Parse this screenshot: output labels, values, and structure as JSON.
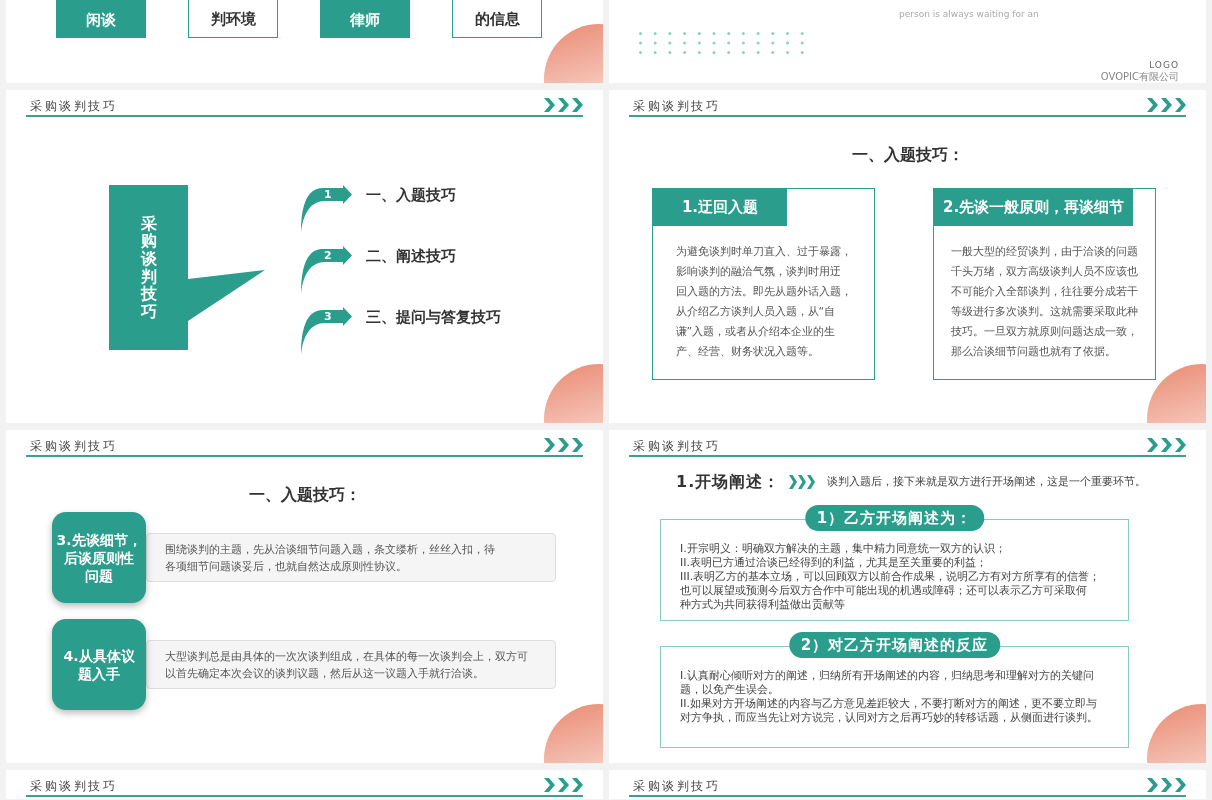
{
  "slides": [
    {
      "kind": "boxes",
      "boxes": [
        {
          "kind": "filled",
          "text": "闲谈"
        },
        {
          "kind": "outline",
          "text": "判环境"
        },
        {
          "kind": "filled",
          "text": "律师"
        },
        {
          "kind": "outline",
          "text": "的信息"
        }
      ]
    },
    {
      "kind": "cover",
      "tagline": "person is always waiting for an",
      "logo": "LOGO",
      "company": "OVOPIC有限公司"
    },
    {
      "kind": "agenda",
      "header": "采购谈判技巧",
      "title": "采购谈判技巧",
      "items": [
        {
          "number": "1",
          "label": "一、入题技巧"
        },
        {
          "number": "2",
          "label": "二、阐述技巧"
        },
        {
          "number": "3",
          "label": "三、提问与答复技巧"
        }
      ]
    },
    {
      "kind": "cards",
      "header": "采购谈判技巧",
      "heading": "一、入题技巧：",
      "cards": [
        {
          "title": "1.迂回入题",
          "lines": [
            "为避免谈判时单刀直入、过于暴露，",
            "影响谈判的融洽气氛，谈判时用迂",
            "回入题的方法。即先从题外话入题，",
            "从介绍乙方谈判人员入题，从“自",
            "谦”入题，或者从介绍本企业的生",
            "产、经营、财务状况入题等。"
          ]
        },
        {
          "title": "2.先谈一般原则，再谈细节",
          "lines": [
            "一般大型的经贸谈判，由于洽谈的问题",
            "千头万绪，双方高级谈判人员不应该也",
            "不可能介入全部谈判，往往要分成若干",
            "等级进行多次谈判。这就需要采取此种",
            "技巧。一旦双方就原则问题达成一致，",
            "那么洽谈细节问题也就有了依据。"
          ]
        }
      ]
    },
    {
      "kind": "rows",
      "header": "采购谈判技巧",
      "heading": "一、入题技巧：",
      "rows": [
        {
          "title_lines": [
            "3.先谈细节，",
            "后谈原则性",
            "问题"
          ],
          "lines": [
            "围绕谈判的主题，先从洽谈细节问题入题，条文缕析，丝丝入扣，待",
            "各项细节问题谈妥后，也就自然达成原则性协议。"
          ]
        },
        {
          "title_lines": [
            "4.从具体议",
            "题入手"
          ],
          "lines": [
            "大型谈判总是由具体的一次次谈判组成，在具体的每一次谈判会上，双方可",
            "以首先确定本次会议的谈判议题，然后从这一议题入手就行洽谈。"
          ]
        }
      ]
    },
    {
      "kind": "statement",
      "header": "采购谈判技巧",
      "heading": "1.开场阐述：",
      "intro": "谈判入题后，接下来就是双方进行开场阐述，这是一个重要环节。",
      "sections": [
        {
          "title": "1）乙方开场阐述为：",
          "lines": [
            "I.开宗明义：明确双方解决的主题，集中精力同意统一双方的认识；",
            "II.表明已方通过洽谈已经得到的利益，尤其是至关重要的利益；",
            "III.表明乙方的基本立场，可以回顾双方以前合作成果，说明乙方有对方所享有的信誉；",
            "也可以展望或预测今后双方合作中可能出现的机遇或障碍；还可以表示乙方可采取何",
            "种方式为共同获得利益做出贡献等"
          ]
        },
        {
          "title": "2）对乙方开场阐述的反应",
          "lines": [
            "I.认真耐心倾听对方的阐述，归纳所有开场阐述的内容，归纳思考和理解对方的关键问",
            "题，以免产生误会。",
            "II.如果对方开场阐述的内容与乙方意见差距较大，不要打断对方的阐述，更不要立即与",
            "对方争执，而应当先让对方说完，认同对方之后再巧妙的转移话题，从侧面进行谈判。"
          ]
        }
      ]
    },
    {
      "kind": "header_only",
      "header": "采购谈判技巧"
    },
    {
      "kind": "header_only",
      "header": "采购谈判技巧"
    }
  ]
}
